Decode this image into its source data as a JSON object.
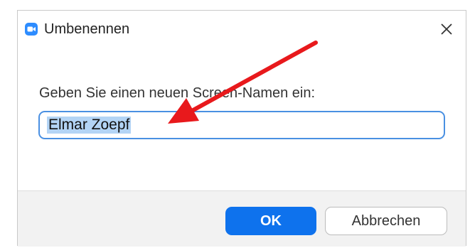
{
  "dialog": {
    "title": "Umbenennen",
    "app_icon": "zoom-video-icon",
    "close_icon": "close-icon",
    "prompt": "Geben Sie einen neuen Screen-Namen ein:",
    "input_value": "Elmar Zoepf",
    "ok_label": "OK",
    "cancel_label": "Abbrechen"
  },
  "annotation": {
    "arrow_color": "#e8191c"
  },
  "colors": {
    "accent": "#0e72ed",
    "input_border": "#4a90e2",
    "selection": "#b3d4f5"
  }
}
